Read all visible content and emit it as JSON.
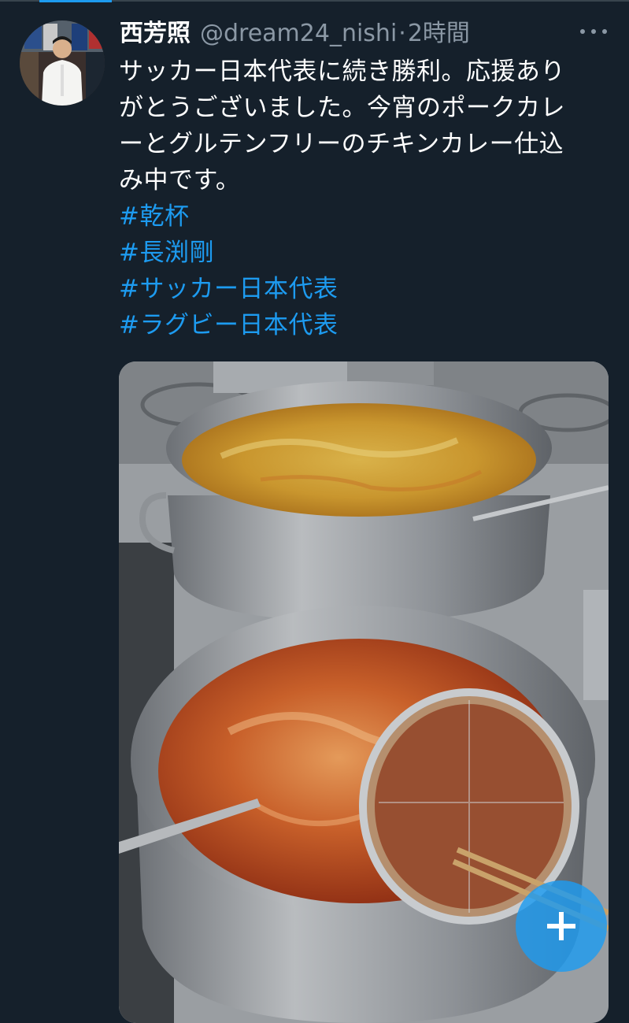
{
  "tweet": {
    "author_name": "西芳照",
    "author_handle": "@dream24_nishi",
    "separator": "·",
    "timestamp": "2時間",
    "text_lines": [
      "サッカー日本代表に続き勝利。応援あり",
      "がとうございました。今宵のポークカレ",
      "ーとグルテンフリーのチキンカレー仕込",
      "み中です。"
    ],
    "hashtags": [
      "#乾杯",
      "#長渕剛",
      "#サッカー日本代表",
      "#ラグビー日本代表"
    ]
  },
  "icons": {
    "more": "more-horizontal-icon",
    "compose": "plus-icon"
  },
  "colors": {
    "background": "#15202b",
    "text": "#ffffff",
    "secondary_text": "#8b98a5",
    "accent": "#1d9bf0"
  }
}
